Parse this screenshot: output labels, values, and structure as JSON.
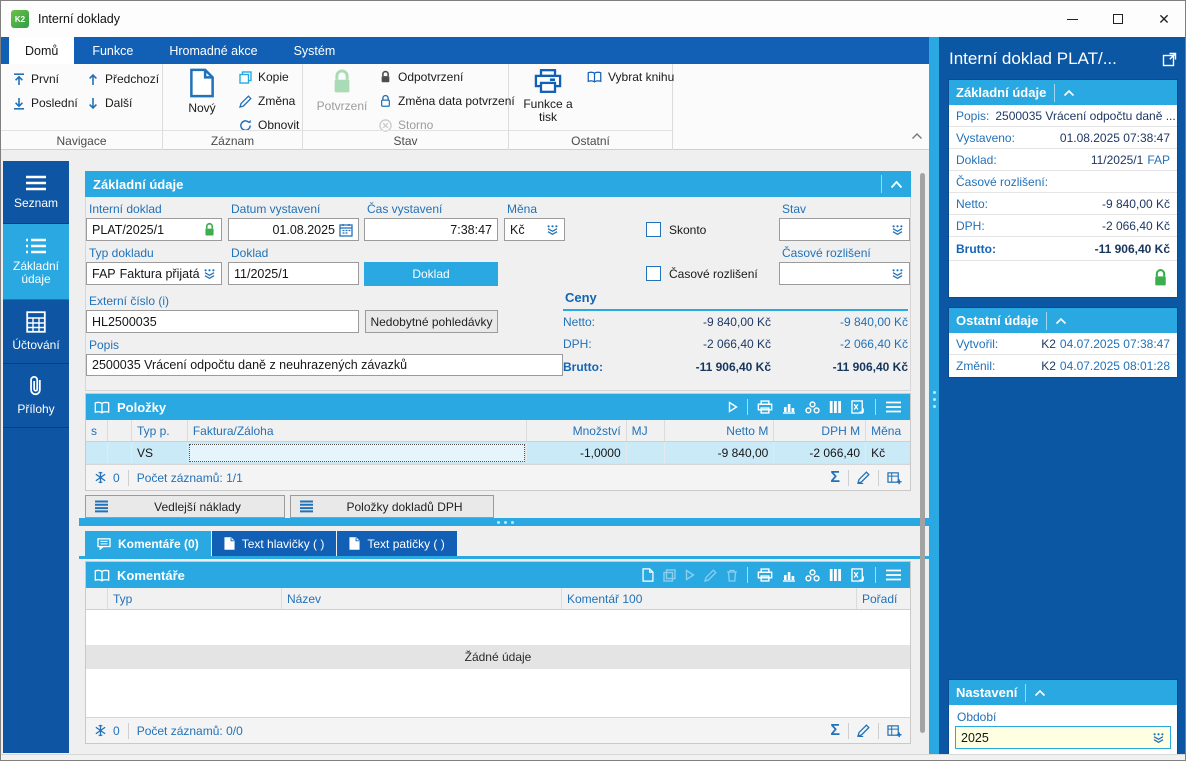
{
  "window": {
    "title": "Interní doklady",
    "logo": "K2"
  },
  "ribbon": {
    "tabs": [
      {
        "label": "Domů"
      },
      {
        "label": "Funkce"
      },
      {
        "label": "Hromadné akce"
      },
      {
        "label": "Systém"
      }
    ],
    "groups": {
      "navigace": {
        "label": "Navigace",
        "first": "První",
        "last": "Poslední",
        "prev": "Předchozí",
        "next": "Další"
      },
      "zaznam": {
        "label": "Záznam",
        "new": "Nový",
        "copy": "Kopie",
        "change": "Změna",
        "refresh": "Obnovit"
      },
      "stav": {
        "label": "Stav",
        "confirm": "Potvrzení",
        "unconfirm": "Odpotvrzení",
        "change_date": "Změna data potvrzení",
        "storno": "Storno"
      },
      "ostatni": {
        "label": "Ostatní",
        "functions": "Funkce a tisk",
        "select_book": "Vybrat knihu"
      }
    }
  },
  "sidebar": {
    "items": [
      {
        "label": "Seznam"
      },
      {
        "label": "Základní údaje"
      },
      {
        "label": "Účtování"
      },
      {
        "label": "Přílohy"
      }
    ]
  },
  "form": {
    "section_title": "Základní údaje",
    "interni_doklad": {
      "label": "Interní doklad",
      "value": "PLAT/2025/1"
    },
    "datum": {
      "label": "Datum vystavení",
      "value": "01.08.2025"
    },
    "cas": {
      "label": "Čas vystavení",
      "value": "7:38:47"
    },
    "mena": {
      "label": "Měna",
      "value": "Kč"
    },
    "skonto": {
      "label": "Skonto"
    },
    "stav": {
      "label": "Stav",
      "value": ""
    },
    "typ": {
      "label": "Typ dokladu",
      "code": "FAP",
      "value": "Faktura přijatá"
    },
    "doklad": {
      "label": "Doklad",
      "value": "11/2025/1"
    },
    "doklad_button": "Doklad",
    "casove": {
      "label": "Časové rozlišení",
      "value": ""
    },
    "externi": {
      "label": "Externí číslo (i)",
      "value": "HL2500035"
    },
    "nedobytne_button": "Nedobytné pohledávky",
    "popis": {
      "label": "Popis",
      "value": "2500035 Vrácení odpočtu daně z neuhrazených závazků"
    },
    "ceny": {
      "title": "Ceny",
      "rows": [
        {
          "label": "Netto:",
          "v1": "-9 840,00 Kč",
          "v2": "-9 840,00 Kč"
        },
        {
          "label": "DPH:",
          "v1": "-2 066,40 Kč",
          "v2": "-2 066,40 Kč"
        },
        {
          "label": "Brutto:",
          "v1": "-11 906,40 Kč",
          "v2": "-11 906,40 Kč"
        }
      ]
    }
  },
  "polozky": {
    "title": "Položky",
    "columns": [
      "s",
      "",
      "Typ p.",
      "Faktura/Záloha",
      "Množství",
      "MJ",
      "Netto M",
      "DPH M",
      "Měna"
    ],
    "row": {
      "typ": "VS",
      "mnozstvi": "-1,0000",
      "netto": "-9 840,00",
      "dph": "-2 066,40",
      "mena": "Kč"
    },
    "frozen": "0",
    "count": "Počet záznamů: 1/1"
  },
  "buttons": {
    "vedlejsi": "Vedlejší náklady",
    "polozky_dph": "Položky dokladů DPH"
  },
  "tabs": [
    {
      "label": "Komentáře (0)"
    },
    {
      "label": "Text hlavičky ( )"
    },
    {
      "label": "Text patičky ( )"
    }
  ],
  "komentare": {
    "title": "Komentáře",
    "columns": [
      "Typ",
      "Název",
      "Komentář 100",
      "Pořadí"
    ],
    "empty": "Žádné údaje",
    "frozen": "0",
    "count": "Počet záznamů: 0/0"
  },
  "panel": {
    "title": "Interní doklad PLAT/...",
    "zakladni": {
      "title": "Základní údaje",
      "rows": [
        {
          "label": "Popis:",
          "value": "2500035 Vrácení odpočtu daně ..."
        },
        {
          "label": "Vystaveno:",
          "value": "01.08.2025 07:38:47"
        },
        {
          "label": "Doklad:",
          "value": "11/2025/1",
          "tag": "FAP"
        },
        {
          "label": "Časové rozlišení:",
          "value": ""
        },
        {
          "label": "Netto:",
          "value": "-9 840,00 Kč"
        },
        {
          "label": "DPH:",
          "value": "-2 066,40 Kč"
        },
        {
          "label": "Brutto:",
          "value": "-11 906,40 Kč"
        }
      ]
    },
    "ostatni": {
      "title": "Ostatní údaje",
      "rows": [
        {
          "label": "Vytvořil:",
          "user": "K2",
          "value": "04.07.2025 07:38:47"
        },
        {
          "label": "Změnil:",
          "user": "K2",
          "value": "04.07.2025 08:01:28"
        }
      ]
    },
    "nastaveni": {
      "title": "Nastavení",
      "obdobi_label": "Období",
      "obdobi_value": "2025"
    }
  },
  "colors": {
    "accent_cyan": "#29A8E1",
    "ribbon_blue": "#1160B5",
    "panel_blue": "#0B57A4",
    "label_blue": "#2272B9",
    "green": "#3DAE4E",
    "selection": "#CBEAF8",
    "dropdown_bg": "#FFFFE1"
  }
}
